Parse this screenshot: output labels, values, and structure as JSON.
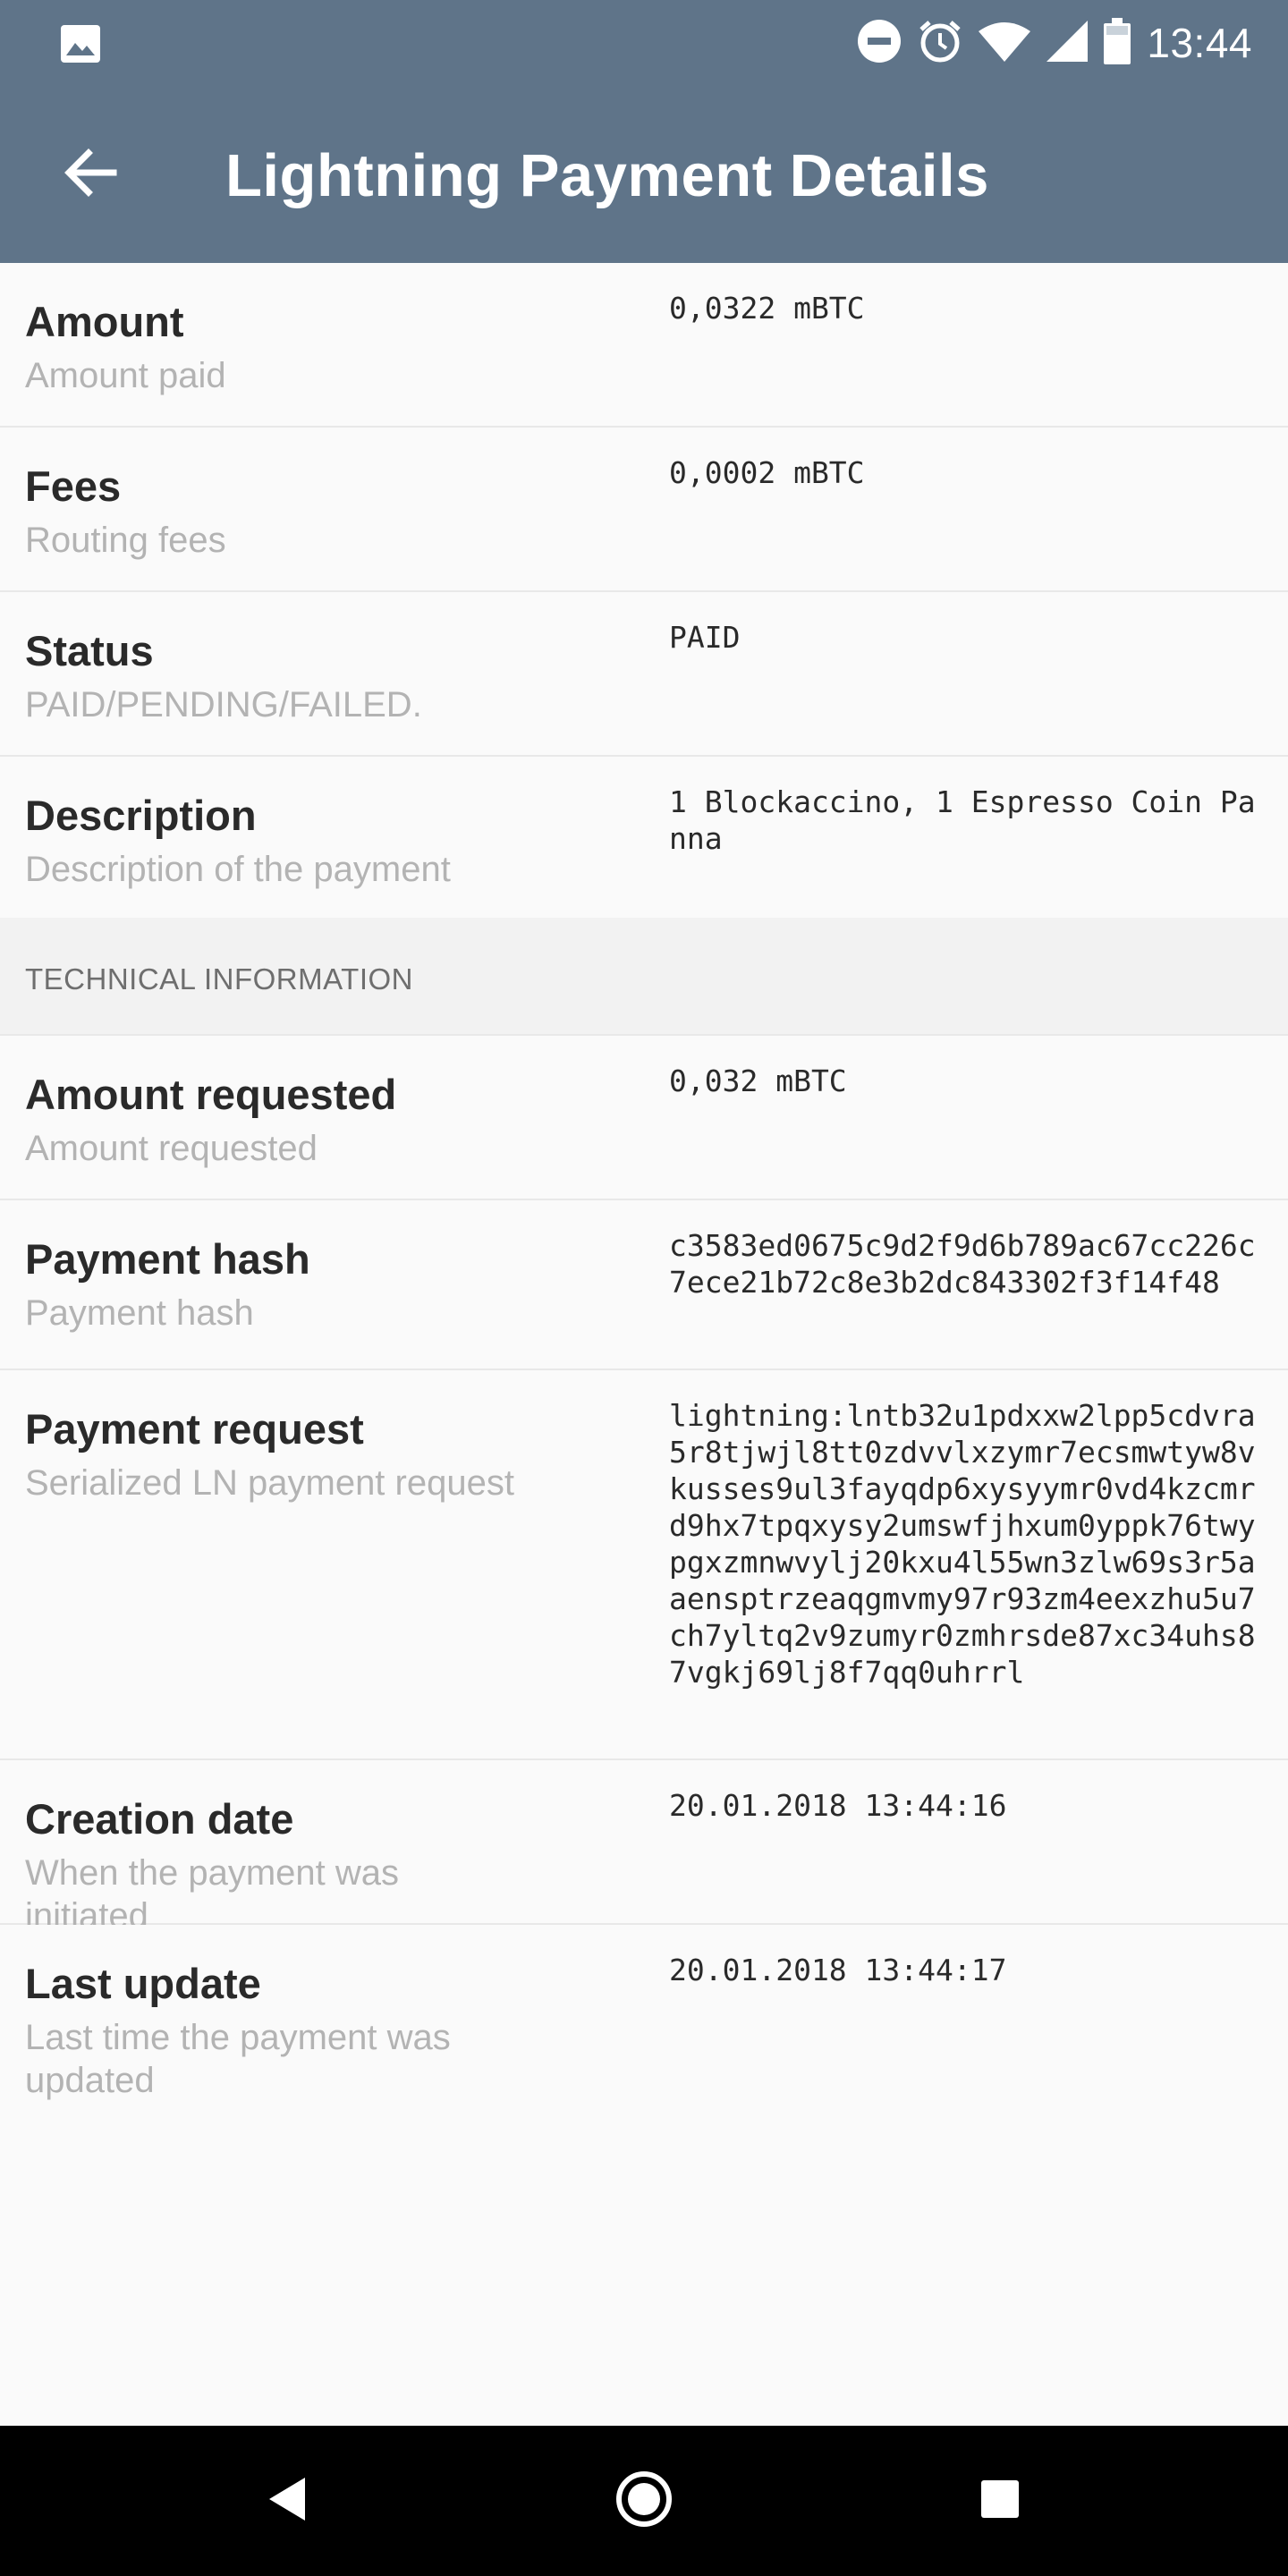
{
  "status_bar": {
    "time": "13:44",
    "icons": [
      "image-icon",
      "do-not-disturb-icon",
      "alarm-icon",
      "wifi-icon",
      "signal-icon",
      "battery-icon"
    ]
  },
  "app_bar": {
    "title": "Lightning Payment Details",
    "back_icon": "arrow-back-icon"
  },
  "details": [
    {
      "label": "Amount",
      "sub": "Amount paid",
      "value": "0,0322 mBTC"
    },
    {
      "label": "Fees",
      "sub": "Routing fees",
      "value": "0,0002 mBTC"
    },
    {
      "label": "Status",
      "sub": "PAID/PENDING/FAILED.",
      "value": "PAID"
    },
    {
      "label": "Description",
      "sub": "Description of the payment",
      "value": "1 Blockaccino, 1 Espresso Coin Panna"
    }
  ],
  "technical": {
    "header": "TECHNICAL INFORMATION",
    "rows": [
      {
        "label": "Amount requested",
        "sub": "Amount requested",
        "value": "0,032 mBTC"
      },
      {
        "label": "Payment hash",
        "sub": "Payment hash",
        "value": "c3583ed0675c9d2f9d6b789ac67cc226c7ece21b72c8e3b2dc843302f3f14f48"
      },
      {
        "label": "Payment request",
        "sub": "Serialized LN payment request",
        "value": "lightning:lntb32u1pdxxw2lpp5cdvra5r8tjwjl8tt0zdvvlxzymr7ecsmwtyw8vkusses9ul3fayqdp6xysyymr0vd4kzcmrd9hx7tpqxysy2umswfjhxum0yppk76twypgxzmnwvylj20kxu4l55wn3zlw69s3r5aaensptrzeaqgmvmy97r93zm4eexzhu5u7ch7yltq2v9zumyr0zmhrsde87xc34uhs87vgkj69lj8f7qq0uhrrl"
      },
      {
        "label": "Creation date",
        "sub": "When the payment was initiated",
        "value": "20.01.2018 13:44:16"
      },
      {
        "label": "Last update",
        "sub": "Last time the payment was updated",
        "value": "20.01.2018 13:44:17"
      }
    ]
  },
  "nav_bar": {
    "icons": [
      "nav-back-icon",
      "nav-home-icon",
      "nav-recents-icon"
    ]
  }
}
